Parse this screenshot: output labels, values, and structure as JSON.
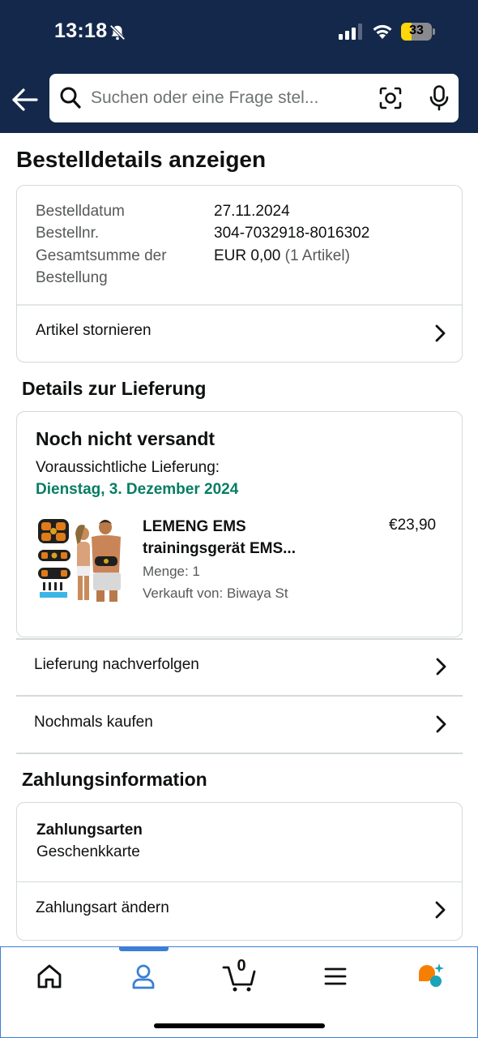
{
  "status_bar": {
    "time": "13:18",
    "battery": "33",
    "battery_level": 0.33
  },
  "search": {
    "placeholder": "Suchen oder eine Frage stel..."
  },
  "page": {
    "title": "Bestelldetails anzeigen"
  },
  "order_summary": {
    "date_label": "Bestelldatum",
    "date_value": "27.11.2024",
    "number_label": "Bestellnr.",
    "number_value": "304-7032918-8016302",
    "total_label_line1": "Gesamtsumme der",
    "total_label_line2": "Bestellung",
    "total_value": "EUR 0,00",
    "total_items": "(1 Artikel)",
    "cancel_label": "Artikel stornieren"
  },
  "delivery": {
    "section_title": "Details zur Lieferung",
    "status": "Noch nicht versandt",
    "estimate_label": "Voraussichtliche Lieferung:",
    "estimate_date": "Dienstag, 3. Dezember 2024",
    "product": {
      "name_line1": "LEMENG EMS",
      "name_line2": "trainingsgerät EMS...",
      "price": "€23,90",
      "quantity": "Menge: 1",
      "seller": "Verkauft von: Biwaya St"
    },
    "track_label": "Lieferung nachverfolgen",
    "buy_again_label": "Nochmals kaufen"
  },
  "payment": {
    "section_title": "Zahlungsinformation",
    "methods_heading": "Zahlungsarten",
    "method": "Geschenkkarte",
    "change_label": "Zahlungsart ändern"
  },
  "cart": {
    "count": "0"
  },
  "colors": {
    "header_bg": "#14284b",
    "delivery_green": "#067d62",
    "nav_accent": "#3b7fd6",
    "rufus_orange": "#f77f00",
    "rufus_teal": "#1ba3b8"
  },
  "icons": [
    "back-arrow-icon",
    "search-icon",
    "camera-scan-icon",
    "mic-icon",
    "chevron-right-icon",
    "home-icon",
    "account-icon",
    "cart-icon",
    "menu-icon",
    "rufus-assistant-icon"
  ]
}
